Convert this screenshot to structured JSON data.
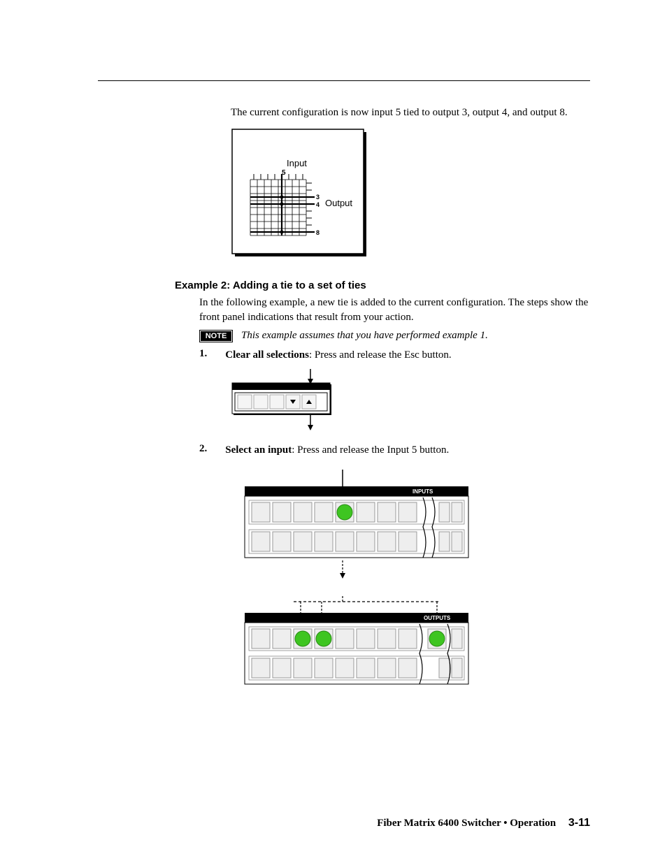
{
  "intro": "The current configuration is now input 5 tied to output 3, output 4, and output 8.",
  "fig1": {
    "top_label": "Input",
    "top_num": "5",
    "right_label": "Output",
    "right_nums": [
      "3",
      "4",
      "8"
    ]
  },
  "heading": "Example 2: Adding a tie to a set of ties",
  "sub_para": "In the following example, a new tie is added to the current configuration.  The steps show the front panel indications that result from your action.",
  "note_badge": "NOTE",
  "note_text": "This example assumes that you have performed example 1.",
  "step1_num": "1",
  "step1_bold": "Clear all selections",
  "step1_rest": ": Press and release the Esc button.",
  "step2_num": "2",
  "step2_bold": "Select an input",
  "step2_rest": ": Press and release the Input 5 button.",
  "panel_inputs_label": "INPUTS",
  "panel_outputs_label": "OUTPUTS",
  "footer_product": "Fiber Matrix 6400 Switcher • Operation",
  "footer_page": "3-11"
}
